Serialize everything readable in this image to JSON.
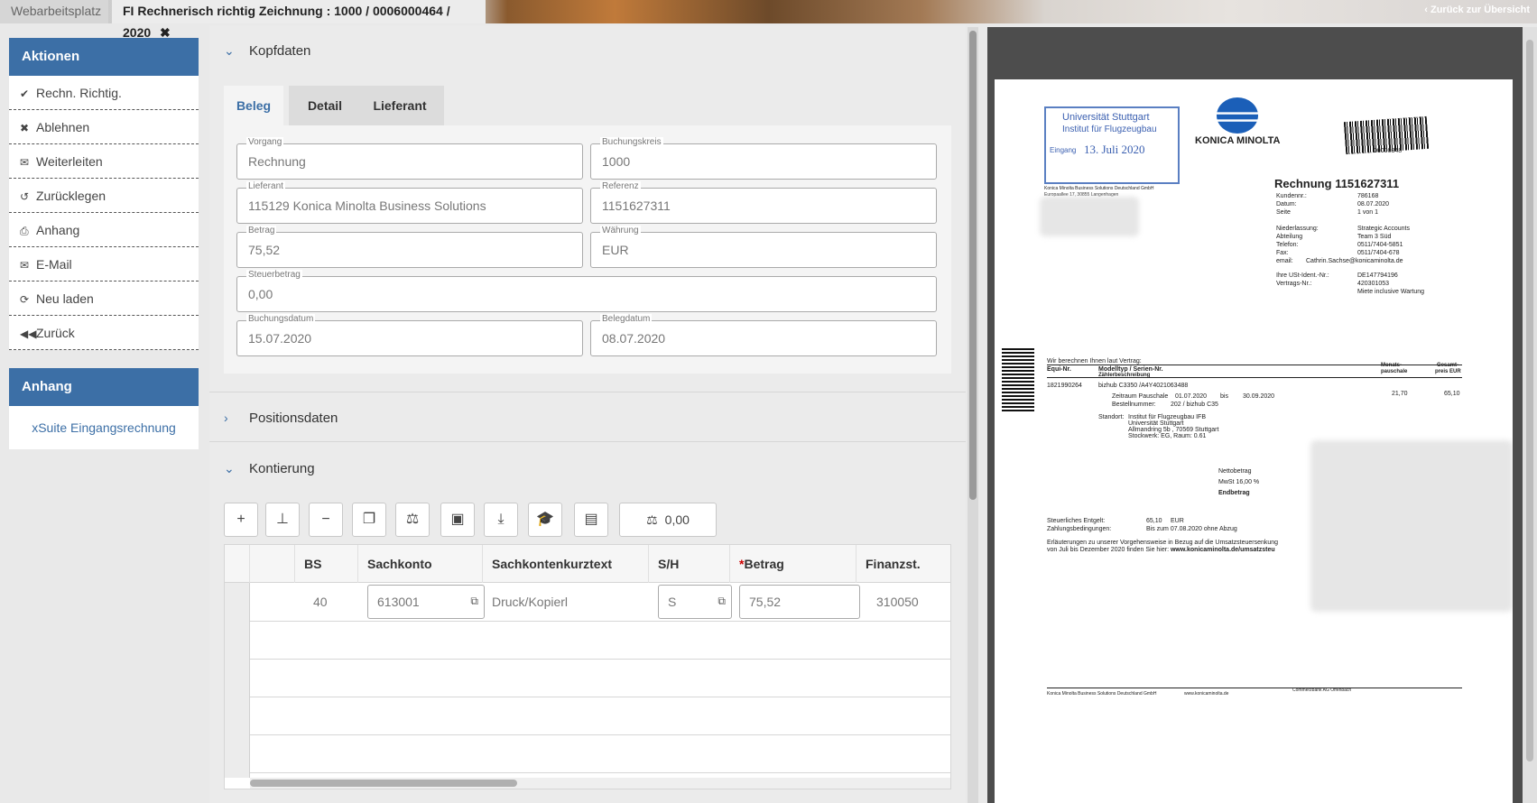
{
  "tabs": {
    "workspace": "Webarbeitsplatz",
    "active": "FI Rechnerisch richtig Zeichnung : 1000 / 0006000464 / 2020",
    "close_icon": "✖",
    "back_link": "Zurück zur Übersicht"
  },
  "actions": {
    "title": "Aktionen",
    "items": [
      {
        "icon": "✔",
        "label": "Rechn. Richtig."
      },
      {
        "icon": "✖",
        "label": "Ablehnen"
      },
      {
        "icon": "✉",
        "label": "Weiterleiten"
      },
      {
        "icon": "↺",
        "label": "Zurücklegen"
      },
      {
        "icon": "⎙",
        "label": "Anhang"
      },
      {
        "icon": "✉",
        "label": "E-Mail"
      },
      {
        "icon": "⟳",
        "label": "Neu laden"
      },
      {
        "icon": "◀◀",
        "label": "Zurück"
      }
    ]
  },
  "attachment_panel": {
    "title": "Anhang",
    "item": "xSuite Eingangsrechnung"
  },
  "kopfdaten": {
    "title": "Kopfdaten",
    "tabs": [
      "Beleg",
      "Detail",
      "Lieferant"
    ],
    "fields": {
      "vorgang": {
        "label": "Vorgang",
        "value": "Rechnung"
      },
      "buchungskreis": {
        "label": "Buchungskreis",
        "value": "1000"
      },
      "lieferant": {
        "label": "Lieferant",
        "value": "115129 Konica Minolta Business Solutions"
      },
      "referenz": {
        "label": "Referenz",
        "value": "1151627311"
      },
      "betrag": {
        "label": "Betrag",
        "value": "75,52"
      },
      "waehrung": {
        "label": "Währung",
        "value": "EUR"
      },
      "steuerbetrag": {
        "label": "Steuerbetrag",
        "value": "0,00"
      },
      "buchungsdatum": {
        "label": "Buchungsdatum",
        "value": "15.07.2020"
      },
      "belegdatum": {
        "label": "Belegdatum",
        "value": "08.07.2020"
      }
    }
  },
  "positionsdaten": {
    "title": "Positionsdaten"
  },
  "kontierung": {
    "title": "Kontierung",
    "toolbar": {
      "icons": [
        "plus-icon",
        "hierarchy-icon",
        "minus-icon",
        "copy-icon",
        "balance-icon",
        "save-icon",
        "download-icon",
        "graduation-cap-icon",
        "excel-icon"
      ],
      "balance_value": "0,00"
    },
    "columns": [
      "BS",
      "Sachkonto",
      "Sachkontenkurztext",
      "S/H",
      "Betrag",
      "Finanzst."
    ],
    "required_mark": "*",
    "rows": [
      {
        "bs": "40",
        "sachkonto": "613001",
        "kurztext": "Druck/Kopierl",
        "sh": "S",
        "betrag": "75,52",
        "finanzst": "310050"
      }
    ]
  },
  "document": {
    "stamp": {
      "line1": "Universität Stuttgart",
      "line2": "Institut für Flugzeugbau",
      "eingang": "Eingang",
      "date": "13. Juli 2020"
    },
    "brand": "KONICA MINOLTA",
    "barcode_no": "00000348",
    "sender_line": "Konica Minolta Business Solutions Deutschland GmbH",
    "sender_addr": "Europaallee 17, 30855 Langenhagen",
    "invoice_label": "Rechnung",
    "invoice_no": "1151627311",
    "meta": [
      [
        "Kundennr.:",
        "786168"
      ],
      [
        "Datum:",
        "08.07.2020"
      ],
      [
        "Seite",
        "1 von 1"
      ],
      [
        "Niederlassung:",
        "Strategic Accounts"
      ],
      [
        "Abteilung",
        "Team 3 Süd"
      ],
      [
        "Telefon:",
        "0511/7404-5851"
      ],
      [
        "Fax:",
        "0511/7404-678"
      ],
      [
        "email:",
        "Cathrin.Sachse@konicaminolta.de"
      ],
      [
        "Ihre USt-Ident.-Nr.:",
        "DE147794196"
      ],
      [
        "Vertrags-Nr.:",
        "420301053"
      ],
      [
        "",
        "Miete inclusive Wartung"
      ]
    ],
    "intro": "Wir berechnen Ihnen laut Vertrag:",
    "col_equi": "Equi-Nr.",
    "col_model": "Modelltyp / Serien-Nr.",
    "col_model2": "Zählerbeschreibung",
    "col_monthly": "Monats-",
    "col_monthly2": "pauschale",
    "col_total": "Gesamt-",
    "col_total2": "preis EUR",
    "equi": "1821990264",
    "model": "bizhub C3350 /A4Y4021063488",
    "period_label": "Zeitraum Pauschale",
    "period_from": "01.07.2020",
    "period_bis": "bis",
    "period_to": "30.09.2020",
    "monthly": "21,70",
    "total": "65,10",
    "order_label": "Bestellnummer:",
    "order_value": "202 / bizhub C35",
    "standort_label": "Standort:",
    "standort": [
      "Institut für Flugzeugbau IFB",
      "Universität Stuttgart",
      "Allmandring 5b , 70569 Stuttgart",
      "Stockwerk: EG, Raum: 0.61"
    ],
    "netto": "Nettobetrag",
    "mwst": "MwSt 16,00 %",
    "endbetrag": "Endbetrag",
    "entgelt_label": "Steuerliches Entgelt:",
    "entgelt_value": "65,10",
    "entgelt_cur": "EUR",
    "zahlung_label": "Zahlungsbedingungen:",
    "zahlung_value": "Bis zum 07.08.2020 ohne Abzug",
    "note1": "Erläuterungen zu unserer Vorgehensweise in Bezug auf die Umsatzsteuersenkung",
    "note2": "von Juli bis Dezember 2020 finden Sie hier:",
    "note_url": "www.konicaminolta.de/umsatzsteu",
    "footer": [
      "Konica Minolta Business Solutions Deutschland GmbH",
      "www.konicaminolta.de",
      "Commerzbank AG Offenbach"
    ]
  }
}
